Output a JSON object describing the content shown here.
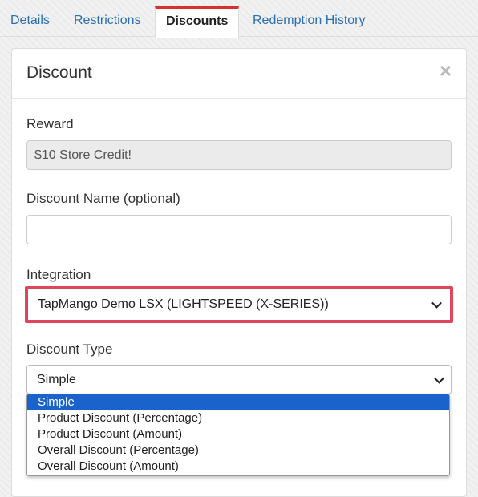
{
  "tabs": [
    {
      "label": "Details"
    },
    {
      "label": "Restrictions"
    },
    {
      "label": "Discounts"
    },
    {
      "label": "Redemption History"
    }
  ],
  "panel": {
    "title": "Discount",
    "close": "×"
  },
  "reward": {
    "label": "Reward",
    "value": "$10 Store Credit!"
  },
  "discount_name": {
    "label": "Discount Name (optional)",
    "value": ""
  },
  "integration": {
    "label": "Integration",
    "value": "TapMango Demo LSX (LIGHTSPEED (X-SERIES))"
  },
  "discount_type": {
    "label": "Discount Type",
    "value": "Simple",
    "options": [
      "Simple",
      "Product Discount (Percentage)",
      "Product Discount (Amount)",
      "Overall Discount (Percentage)",
      "Overall Discount (Amount)"
    ]
  },
  "colors": {
    "highlight": "#e0465b",
    "tab_accent": "#d9302f",
    "link": "#2a6eb0",
    "selected_option": "#1a63cc"
  }
}
